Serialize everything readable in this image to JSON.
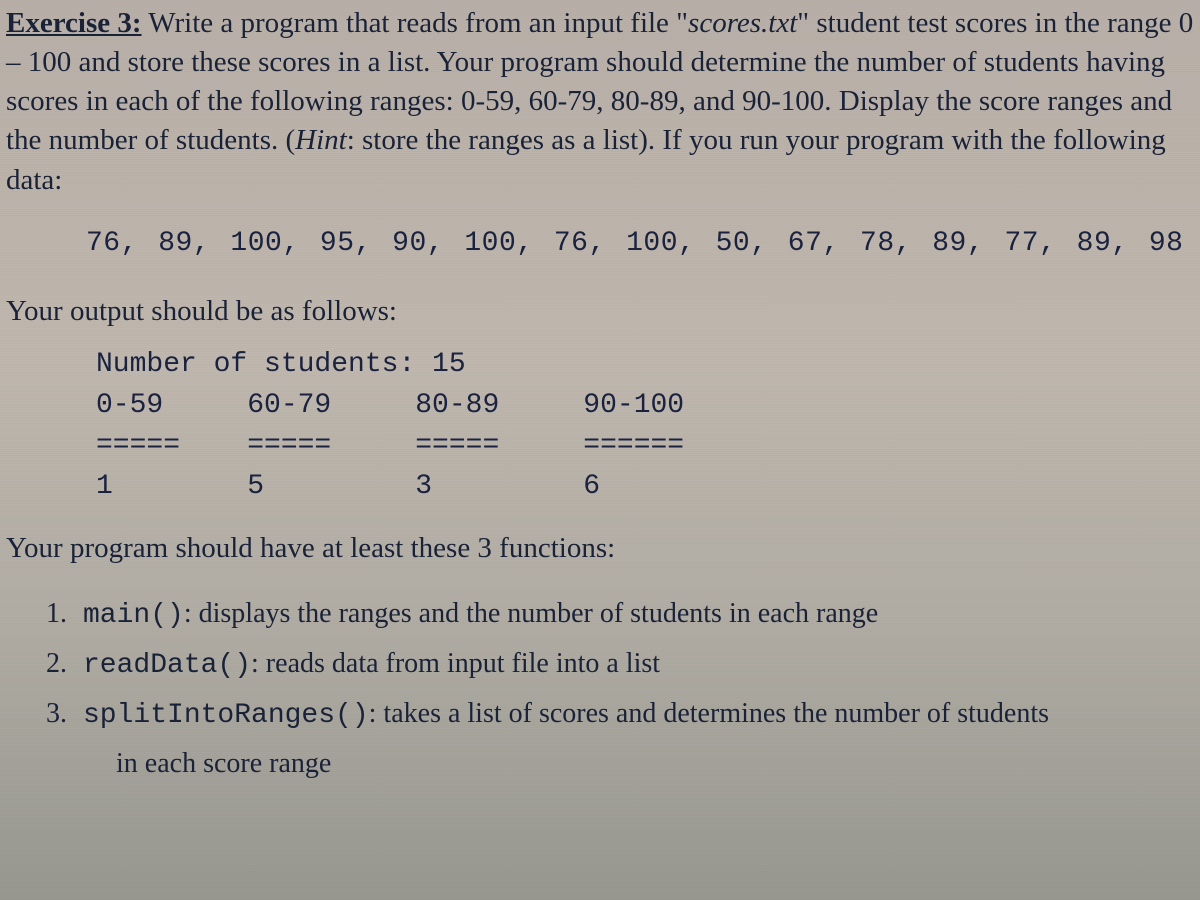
{
  "exercise_label": "Exercise 3:",
  "intro_part1": " Write a program that reads from an input file \"",
  "filename": "scores.txt",
  "intro_part2": "\" student test scores in the range 0 – 100 and store these scores in a list. Your program should determine the number of students having scores in each of the following ranges: 0-59, 60-79, 80-89, and 90-100. Display the score ranges and the number of students. (",
  "hint_label": "Hint",
  "intro_part3": ": store the ranges as a list). If you run your program with the following data:",
  "data_line": "76, 89, 100, 95, 90, 100, 76, 100, 50, 67, 78, 89, 77, 89, 98",
  "output_heading": "Your output should be as follows:",
  "output_text": "Number of students: 15\n0-59     60-79     80-89     90-100\n=====    =====     =====     ======\n1        5         3         6",
  "func_heading": "Your program should have at least these 3 functions:",
  "functions": [
    {
      "num": "1.",
      "name": "main()",
      "desc": ": displays the ranges and the number of students in each range"
    },
    {
      "num": "2.",
      "name": "readData()",
      "desc": ": reads data from input file into a list"
    },
    {
      "num": "3.",
      "name": "splitIntoRanges()",
      "desc": ": takes a list of scores and determines the number of students"
    }
  ],
  "func3_cont": "in each score range",
  "chart_data": {
    "type": "table",
    "title": "Number of students: 15",
    "categories": [
      "0-59",
      "60-79",
      "80-89",
      "90-100"
    ],
    "values": [
      1,
      5,
      3,
      6
    ]
  }
}
